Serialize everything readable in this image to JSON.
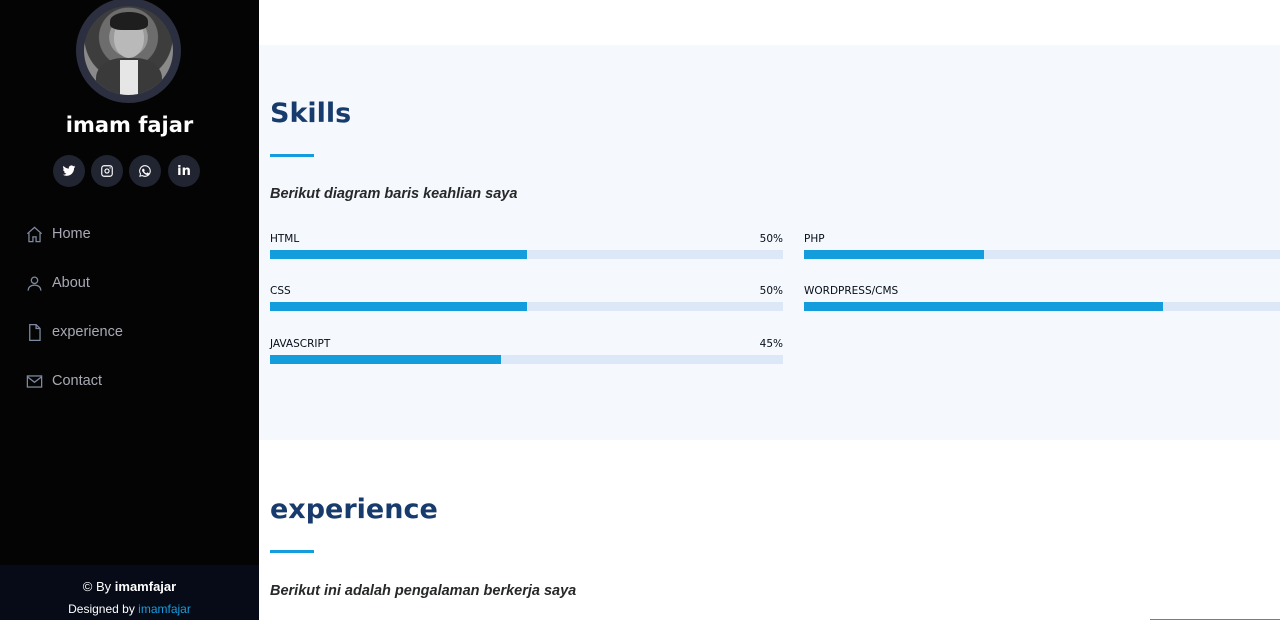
{
  "profile": {
    "name": "imam fajar"
  },
  "social": [
    {
      "icon": "twitter-icon"
    },
    {
      "icon": "instagram-icon"
    },
    {
      "icon": "whatsapp-icon"
    },
    {
      "icon": "linkedin-icon"
    }
  ],
  "nav": [
    {
      "label": "Home",
      "icon": "home-icon"
    },
    {
      "label": "About",
      "icon": "person-icon"
    },
    {
      "label": "experience",
      "icon": "file-icon"
    },
    {
      "label": "Contact",
      "icon": "envelope-icon"
    }
  ],
  "footer": {
    "copyright_prefix": "© By ",
    "copyright_name": "imamfajar",
    "credits_prefix": "Designed by ",
    "credits_link": "imamfajar"
  },
  "skills": {
    "title": "Skills",
    "description": "Berikut diagram baris keahlian saya",
    "items": [
      {
        "name": "HTML",
        "value_text": "50%",
        "value": 0.5
      },
      {
        "name": "CSS",
        "value_text": "50%",
        "value": 0.5
      },
      {
        "name": "JAVASCRIPT",
        "value_text": "45%",
        "value": 0.45
      },
      {
        "name": "PHP",
        "value": 0.35
      },
      {
        "name": "WORDPRESS/CMS",
        "value": 0.7
      }
    ]
  },
  "experience": {
    "title": "experience",
    "description": "Berikut ini adalah pengalaman berkerja saya"
  },
  "colors": {
    "sidebar_bg": "#040404",
    "accent": "#149ddd",
    "heading": "#173b6c",
    "section_bg": "#f5f8fd"
  }
}
